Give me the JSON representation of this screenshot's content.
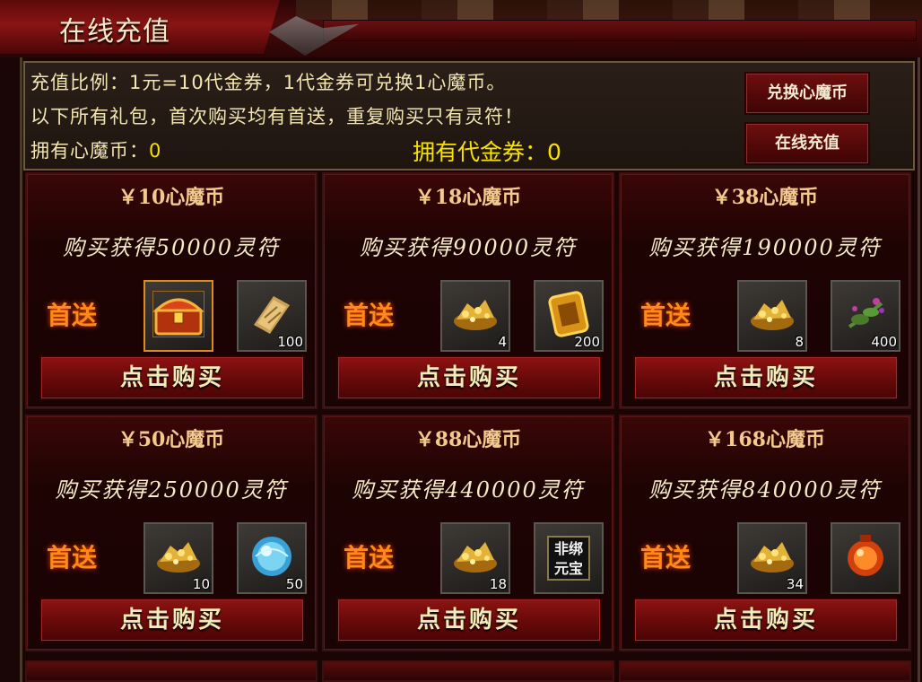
{
  "window": {
    "title": "在线充值"
  },
  "info": {
    "line1": "充值比例：1元=10代金券，1代金券可兑换1心魔币。",
    "line2": "以下所有礼包，首次购买均有首送，重复购买只有灵符！",
    "coins_label": "拥有心魔币：",
    "coins_value": "0",
    "vouchers_label": "拥有代金券：",
    "vouchers_value": "0"
  },
  "buttons": {
    "exchange": "兑换心魔币",
    "recharge": "在线充值"
  },
  "first_gift_label": "首送",
  "buy_label": "点击购买",
  "packs": [
    {
      "price": "￥10心魔币",
      "reward": "购买获得50000灵符",
      "item1_icon": "treasure-chest-icon",
      "item1_count": "",
      "item2_icon": "scroll-icon",
      "item2_count": "100"
    },
    {
      "price": "￥18心魔币",
      "reward": "购买获得90000灵符",
      "item1_icon": "gold-pile-icon",
      "item1_count": "4",
      "item2_icon": "gold-token-icon",
      "item2_count": "200"
    },
    {
      "price": "￥38心魔币",
      "reward": "购买获得190000灵符",
      "item1_icon": "gold-pile-icon",
      "item1_count": "8",
      "item2_icon": "herb-icon",
      "item2_count": "400"
    },
    {
      "price": "￥50心魔币",
      "reward": "购买获得250000灵符",
      "item1_icon": "gold-pile-icon",
      "item1_count": "10",
      "item2_icon": "blue-orb-icon",
      "item2_count": "50"
    },
    {
      "price": "￥88心魔币",
      "reward": "购买获得440000灵符",
      "item1_icon": "gold-pile-icon",
      "item1_count": "18",
      "item2_icon": "ingot-tag-icon",
      "item2_text": "非绑元宝",
      "item2_count": ""
    },
    {
      "price": "￥168心魔币",
      "reward": "购买获得840000灵符",
      "item1_icon": "gold-pile-icon",
      "item1_count": "34",
      "item2_icon": "red-orb-icon",
      "item2_count": ""
    }
  ],
  "colors": {
    "gold_text": "#f7e200",
    "first_gift": "#ff8a1a",
    "panel_red": "#6a0a0a"
  }
}
